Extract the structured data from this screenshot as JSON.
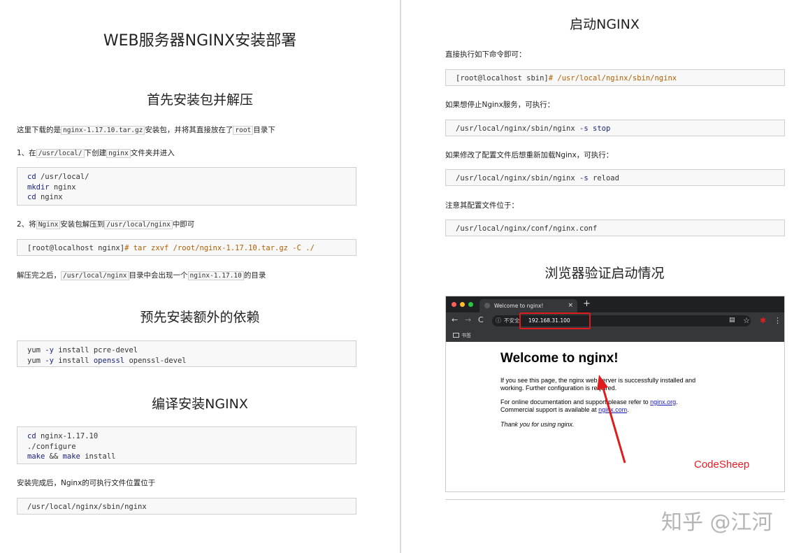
{
  "left": {
    "title": "WEB服务器NGINX安装部署",
    "s1": {
      "heading": "首先安装包并解压",
      "p1": {
        "a": "这里下载的是",
        "c1": "nginx-1.17.10.tar.gz",
        "b": "安装包，并将其直接放在了",
        "c2": "root",
        "d": "目录下"
      },
      "p2": {
        "a": "1、在",
        "c1": "/usr/local/",
        "b": "下创建",
        "c2": "nginx",
        "d": "文件夹并进入"
      },
      "code1": {
        "l1_kw": "cd",
        "l1_rest": " /usr/local/",
        "l2_kw": "mkdir",
        "l2_rest": " nginx",
        "l3_kw": "cd",
        "l3_rest": " nginx"
      },
      "p3": {
        "a": "2、将",
        "c1": "Nginx",
        "b": "安装包解压到",
        "c2": "/usr/local/nginx",
        "d": "中即可"
      },
      "code2": {
        "prompt": "[root@localhost nginx]",
        "cmd": "# tar zxvf /root/nginx-1.17.10.tar.gz -C ./"
      },
      "p4": {
        "a": "解压完之后，",
        "c1": "/usr/local/nginx",
        "b": "目录中会出现一个",
        "c2": "nginx-1.17.10",
        "d": "的目录"
      }
    },
    "s2": {
      "heading": "预先安装额外的依赖",
      "code": {
        "l1_a": "yum ",
        "l1_op": "-y",
        "l1_b": " install pcre-devel",
        "l2_a": "yum ",
        "l2_op": "-y",
        "l2_b": " install ",
        "l2_kw": "openssl",
        "l2_c": " openssl-devel"
      }
    },
    "s3": {
      "heading": "编译安装NGINX",
      "code": {
        "l1_kw": "cd",
        "l1_rest": " nginx-1.17.10",
        "l2": "./configure",
        "l3_kw1": "make",
        "l3_mid": " && ",
        "l3_kw2": "make",
        "l3_rest": " install"
      },
      "p": "安装完成后，Nginx的可执行文件位置位于",
      "code2": "/usr/local/nginx/sbin/nginx"
    }
  },
  "right": {
    "s1": {
      "heading": "启动NGINX",
      "p1": "直接执行如下命令即可：",
      "code1": {
        "prompt": "[root@localhost sbin]",
        "cmd": "# /usr/local/nginx/sbin/nginx"
      },
      "p2": "如果想停止Nginx服务，可执行：",
      "code2": {
        "a": "/usr/local/nginx/sbin/nginx ",
        "op": "-s",
        "b": " stop"
      },
      "p3": "如果修改了配置文件后想重新加载Nginx，可执行：",
      "code3": {
        "a": "/usr/local/nginx/sbin/nginx ",
        "op": "-s",
        "b": " reload"
      },
      "p4": "注意其配置文件位于：",
      "code4": "/usr/local/nginx/conf/nginx.conf"
    },
    "s2": {
      "heading": "浏览器验证启动情况",
      "browser": {
        "tab_title": "Welcome to nginx!",
        "tab_close": "×",
        "new_tab": "+",
        "nav": {
          "back": "←",
          "forward": "→",
          "reload": "C"
        },
        "security_icon": "ⓘ",
        "security_text": "不安全",
        "url": "192.168.31.100",
        "menu_icons": {
          "translate": "▤",
          "star": "☆",
          "ext": "✱",
          "more": "⋮"
        },
        "bookmarks_label": "书签",
        "page": {
          "title": "Welcome to nginx!",
          "p1_l1": "If you see this page, the nginx web server is successfully installed and",
          "p1_l2": "working. Further configuration is required.",
          "p2_l1_a": "For online documentation and support please refer to ",
          "p2_l1_link": "nginx.org",
          "p2_l1_b": ".",
          "p2_l2_a": "Commercial support is available at ",
          "p2_l2_link": "nginx.com",
          "p2_l2_b": ".",
          "p3": "Thank you for using nginx."
        },
        "annotation": "CodeSheep",
        "annotation_color": "#e81c24"
      }
    }
  },
  "watermark": "知乎 @江河"
}
